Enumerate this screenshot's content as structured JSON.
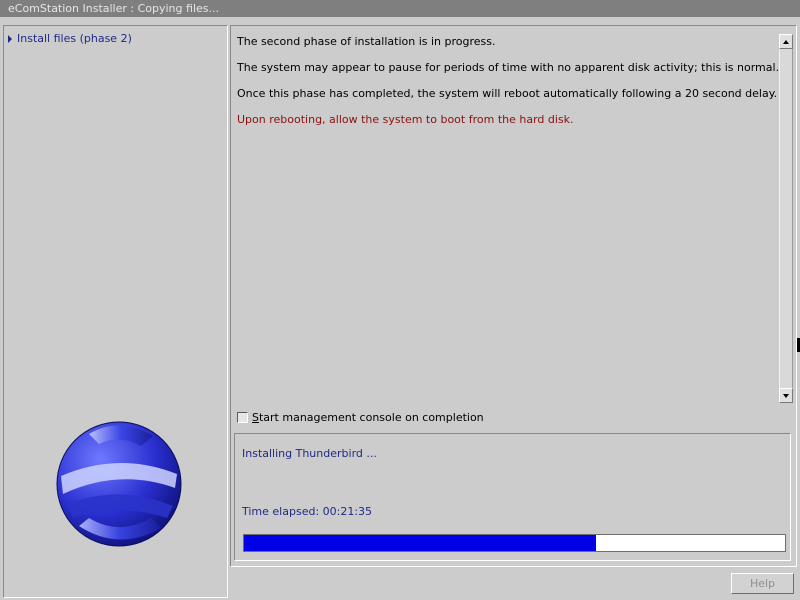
{
  "window": {
    "title": "eComStation Installer : Copying files..."
  },
  "sidebar": {
    "items": [
      {
        "label": "Install files (phase 2)"
      }
    ]
  },
  "messages": {
    "line1": "The second phase of installation is in progress.",
    "line2": "The system may appear to pause for periods of time with no apparent disk activity; this is normal.",
    "line3": "Once this phase has completed, the system will reboot automatically following a 20 second delay.",
    "line4": "Upon rebooting, allow the system to boot from the hard disk."
  },
  "options": {
    "mgmt_console_prefix": "S",
    "mgmt_console_rest": "tart management console on completion",
    "mgmt_console_checked": false
  },
  "status": {
    "current_task": "Installing Thunderbird ...",
    "time_elapsed": "Time elapsed:  00:21:35",
    "progress_fraction": 0.65
  },
  "buttons": {
    "help": "Help"
  },
  "colors": {
    "progress_fill": "#0000e6",
    "warning_text": "#8b1010",
    "link_text": "#1f2a86"
  }
}
